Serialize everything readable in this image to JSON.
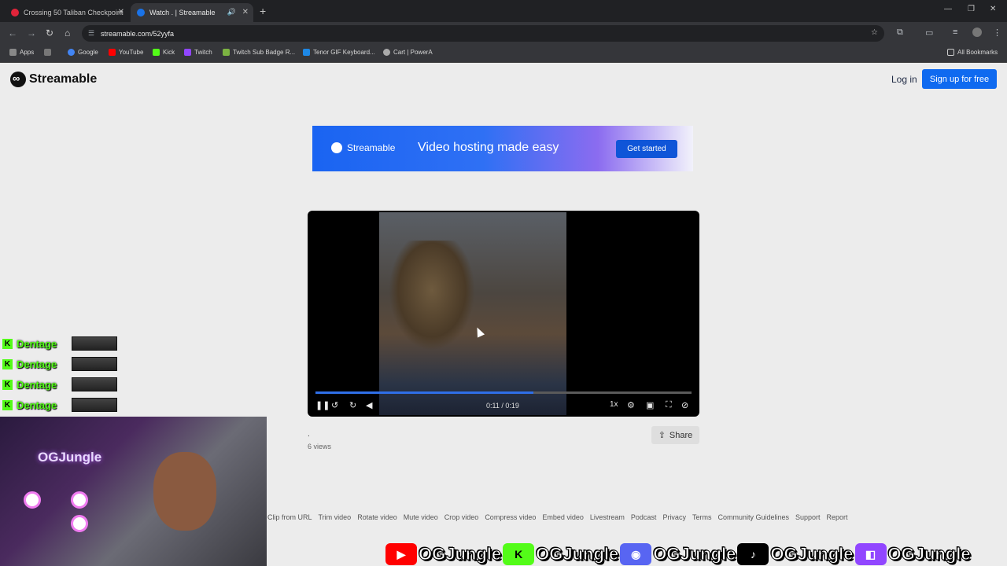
{
  "browser": {
    "tabs": [
      {
        "title": "Crossing 50 Taliban Checkpoint",
        "fav_color": "#e0243a"
      },
      {
        "title": "Watch . | Streamable",
        "fav_color": "#1a73e8"
      }
    ],
    "url": "streamable.com/52yyfa",
    "bookmarks": [
      {
        "label": "Apps",
        "color": "#888888"
      },
      {
        "label": "Google",
        "color": "#4285f4"
      },
      {
        "label": "YouTube",
        "color": "#ff0000"
      },
      {
        "label": "Kick",
        "color": "#53fc18"
      },
      {
        "label": "Twitch",
        "color": "#9146ff"
      },
      {
        "label": "Twitch Sub Badge R...",
        "color": "#7cb342"
      },
      {
        "label": "Tenor GIF Keyboard...",
        "color": "#1e88e5"
      },
      {
        "label": "Cart | PowerA",
        "color": "#aaaaaa"
      }
    ],
    "all_bookmarks": "All Bookmarks"
  },
  "header": {
    "logo": "Streamable",
    "login": "Log in",
    "signup": "Sign up for free"
  },
  "banner": {
    "brand": "Streamable",
    "tagline": "Video hosting made easy",
    "cta": "Get started"
  },
  "player": {
    "progress_fraction": 0.58,
    "time": "0:11 / 0:19",
    "speed": "1x"
  },
  "video_meta": {
    "title": ".",
    "views": "6 views",
    "share": "Share"
  },
  "footer": {
    "links": [
      "Clip from URL",
      "Trim video",
      "Rotate video",
      "Mute video",
      "Crop video",
      "Compress video",
      "Embed video",
      "Livestream",
      "Podcast",
      "Privacy",
      "Terms",
      "Community Guidelines",
      "Support",
      "Report"
    ]
  },
  "overlay": {
    "chat_user": "Dentage",
    "chat_count": 4,
    "channel_name": "OGJungle",
    "socials": [
      {
        "platform": "youtube-icon",
        "color": "#ff0000",
        "name": "OGJungle"
      },
      {
        "platform": "kick-icon",
        "color": "#53fc18",
        "name": "OGJungle"
      },
      {
        "platform": "discord-icon",
        "color": "#5865f2",
        "name": "OGJungle"
      },
      {
        "platform": "tiktok-icon",
        "color": "#000000",
        "name": "OGJungle"
      },
      {
        "platform": "twitch-icon",
        "color": "#9146ff",
        "name": "OGJungle"
      }
    ]
  }
}
